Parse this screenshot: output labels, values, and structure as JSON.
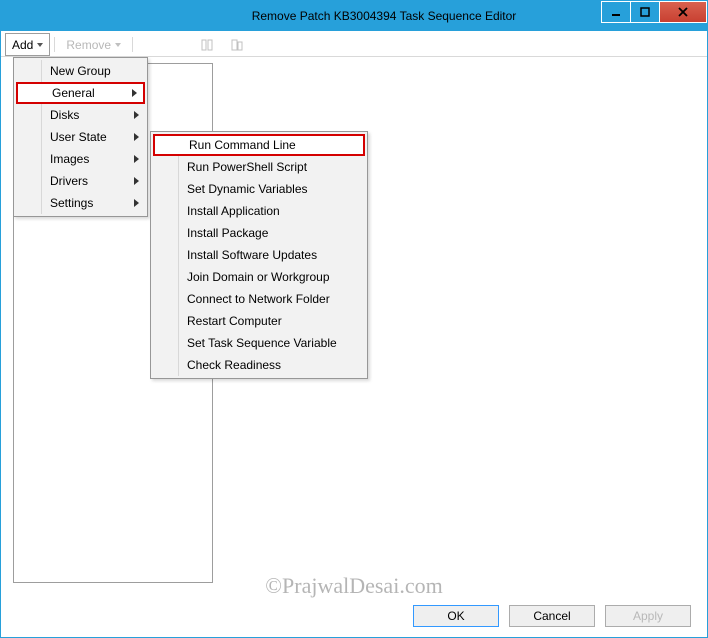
{
  "window": {
    "title": "Remove Patch KB3004394 Task Sequence Editor"
  },
  "toolbar": {
    "add": "Add",
    "remove": "Remove"
  },
  "addMenu": {
    "items": [
      {
        "label": "New Group",
        "hasSub": false,
        "hl": false
      },
      {
        "label": "General",
        "hasSub": true,
        "hl": true
      },
      {
        "label": "Disks",
        "hasSub": true,
        "hl": false
      },
      {
        "label": "User State",
        "hasSub": true,
        "hl": false
      },
      {
        "label": "Images",
        "hasSub": true,
        "hl": false
      },
      {
        "label": "Drivers",
        "hasSub": true,
        "hl": false
      },
      {
        "label": "Settings",
        "hasSub": true,
        "hl": false
      }
    ]
  },
  "generalMenu": {
    "items": [
      {
        "label": "Run Command Line",
        "hl": true
      },
      {
        "label": "Run PowerShell Script",
        "hl": false
      },
      {
        "label": "Set Dynamic Variables",
        "hl": false
      },
      {
        "label": "Install Application",
        "hl": false
      },
      {
        "label": "Install Package",
        "hl": false
      },
      {
        "label": "Install Software Updates",
        "hl": false
      },
      {
        "label": "Join Domain or Workgroup",
        "hl": false
      },
      {
        "label": "Connect to Network Folder",
        "hl": false
      },
      {
        "label": "Restart Computer",
        "hl": false
      },
      {
        "label": "Set Task Sequence Variable",
        "hl": false
      },
      {
        "label": "Check Readiness",
        "hl": false
      }
    ]
  },
  "buttons": {
    "ok": "OK",
    "cancel": "Cancel",
    "apply": "Apply"
  },
  "watermark": "©PrajwalDesai.com"
}
